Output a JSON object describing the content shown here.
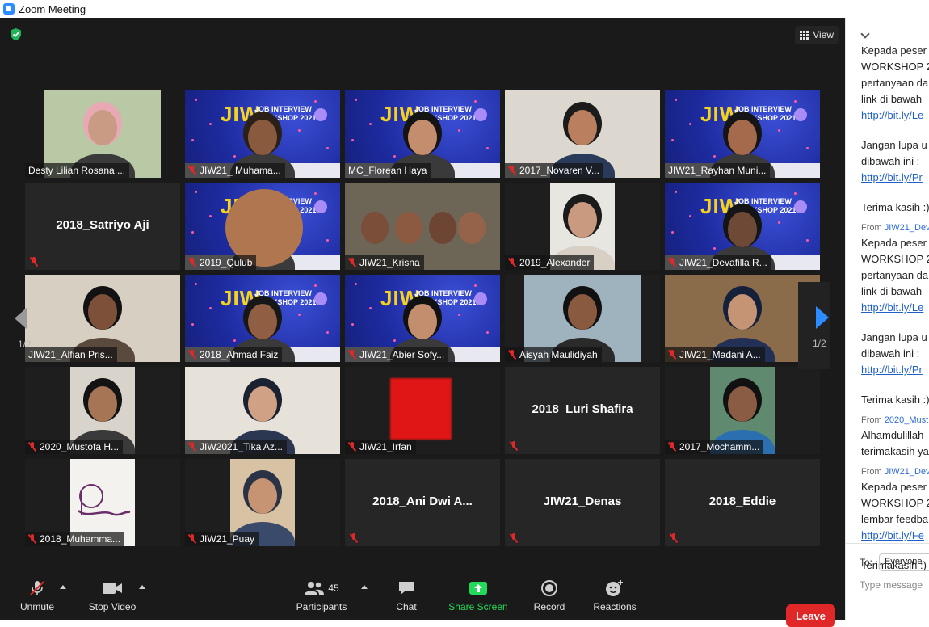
{
  "window": {
    "title": "Zoom Meeting"
  },
  "view_button": {
    "label": "View"
  },
  "pagination": {
    "left_page": "1/2",
    "right_page": "1/2"
  },
  "participants": [
    {
      "name": "Desty Lilian Rosana ...",
      "muted": false,
      "video": true
    },
    {
      "name": "JIW21_ Muhama...",
      "muted": true,
      "video": true
    },
    {
      "name": "MC_Florean Haya",
      "muted": false,
      "video": true
    },
    {
      "name": "2017_Novaren V...",
      "muted": true,
      "video": true
    },
    {
      "name": "JIW21_Rayhan Muni...",
      "muted": false,
      "video": true,
      "active_speaker": true
    },
    {
      "name": "2018_Satriyo Aji",
      "muted": true,
      "video": false
    },
    {
      "name": "2019_Qulub",
      "muted": true,
      "video": true
    },
    {
      "name": "JIW21_Krisna",
      "muted": true,
      "video": true
    },
    {
      "name": "2019_Alexander",
      "muted": true,
      "video": true
    },
    {
      "name": "JIW21_Devafilla R...",
      "muted": true,
      "video": true
    },
    {
      "name": "JIW21_Alfian Pris...",
      "muted": false,
      "video": true
    },
    {
      "name": "2018_Ahmad Faiz",
      "muted": true,
      "video": true
    },
    {
      "name": "JIW21_Abier Sofy...",
      "muted": true,
      "video": true
    },
    {
      "name": "Aisyah Maulidiyah",
      "muted": true,
      "video": true
    },
    {
      "name": "JIW21_Madani A...",
      "muted": true,
      "video": true
    },
    {
      "name": "2020_Mustofa H...",
      "muted": true,
      "video": true
    },
    {
      "name": "JIW2021_Tika Az...",
      "muted": true,
      "video": true
    },
    {
      "name": "JIW21_Irfan",
      "muted": true,
      "video": true
    },
    {
      "name": "2018_Luri Shafira",
      "muted": true,
      "video": false
    },
    {
      "name": "2017_Mochamm...",
      "muted": true,
      "video": true
    },
    {
      "name": "2018_Muhamma...",
      "muted": true,
      "video": true
    },
    {
      "name": "JIW21_Puay",
      "muted": true,
      "video": true
    },
    {
      "name": "2018_Ani Dwi A...",
      "muted": true,
      "video": false
    },
    {
      "name": "JIW21_Denas",
      "muted": true,
      "video": false
    },
    {
      "name": "2018_Eddie",
      "muted": true,
      "video": false
    }
  ],
  "banner": {
    "title": "JIW",
    "subtitle_line1": "JOB INTERVIEW",
    "subtitle_line2": "WORKSHOP 2021"
  },
  "toolbar": {
    "unmute": "Unmute",
    "stop_video": "Stop Video",
    "participants": "Participants",
    "participants_count": "45",
    "chat": "Chat",
    "share_screen": "Share Screen",
    "record": "Record",
    "reactions": "Reactions",
    "leave": "Leave"
  },
  "chat_panel": {
    "messages": [
      {
        "from_prefix": "",
        "from": "",
        "lines": [
          "Kepada peser",
          "WORKSHOP 2",
          "pertanyaan da",
          "link di bawah"
        ],
        "links": [
          "http://bit.ly/Le"
        ]
      },
      {
        "from_prefix": "",
        "from": "",
        "lines": [
          "Jangan lupa u",
          "dibawah ini :"
        ],
        "links": [
          "http://bit.ly/Pr"
        ],
        "after": "Terima kasih :)"
      },
      {
        "from_prefix": "From",
        "from": "JIW21_Dev",
        "lines": [
          "Kepada peser",
          "WORKSHOP 2",
          "pertanyaan da",
          "link di bawah"
        ],
        "links": [
          "http://bit.ly/Le"
        ]
      },
      {
        "from_prefix": "",
        "from": "",
        "lines": [
          "Jangan lupa u",
          "dibawah ini :"
        ],
        "links": [
          "http://bit.ly/Pr"
        ],
        "after": "Terima kasih :)"
      },
      {
        "from_prefix": "From",
        "from": "2020_Must",
        "lines": [
          "Alhamdulillah",
          "terimakasih ya"
        ],
        "links": []
      },
      {
        "from_prefix": "From",
        "from": "JIW21_Dev",
        "lines": [
          "Kepada peser",
          "WORKSHOP 2",
          "lembar feedba"
        ],
        "links": [
          "http://bit.ly/Fe"
        ],
        "after": "Terimakasih :)"
      }
    ],
    "to_label": "To:",
    "recipient": "Everyone",
    "input_placeholder": "Type message"
  },
  "colors": {
    "accent_blue": "#2d8cff",
    "leave_red": "#e02828",
    "active_border": "#c9e85a",
    "share_green": "#23d959"
  }
}
